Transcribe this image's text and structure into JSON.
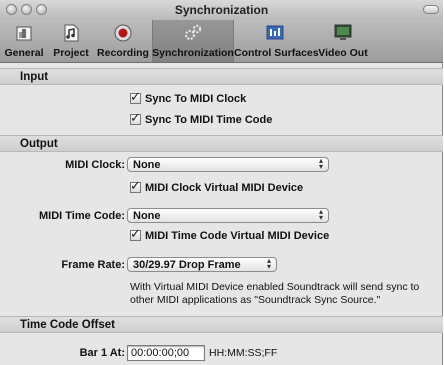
{
  "window": {
    "title": "Synchronization"
  },
  "toolbar": {
    "items": [
      {
        "label": "General",
        "icon": "general-icon"
      },
      {
        "label": "Project",
        "icon": "project-icon"
      },
      {
        "label": "Recording",
        "icon": "record-icon"
      },
      {
        "label": "Synchronization",
        "icon": "sync-gears-icon",
        "selected": true
      },
      {
        "label": "Control Surfaces",
        "icon": "control-surfaces-icon"
      },
      {
        "label": "Video Out",
        "icon": "video-out-icon"
      }
    ]
  },
  "input": {
    "header": "Input",
    "sync_midi_clock": {
      "label": "Sync To MIDI Clock",
      "checked": true
    },
    "sync_midi_time_code": {
      "label": "Sync To MIDI Time Code",
      "checked": true
    }
  },
  "output": {
    "header": "Output",
    "midi_clock_label": "MIDI Clock:",
    "midi_clock_value": "None",
    "midi_clock_virtual": {
      "label": "MIDI Clock Virtual MIDI Device",
      "checked": true
    },
    "midi_time_code_label": "MIDI Time Code:",
    "midi_time_code_value": "None",
    "midi_time_code_virtual": {
      "label": "MIDI Time Code Virtual MIDI Device",
      "checked": true
    },
    "frame_rate_label": "Frame Rate:",
    "frame_rate_value": "30/29.97 Drop Frame",
    "note": "With Virtual MIDI Device enabled Soundtrack will send sync to other MIDI applications as \"Soundtrack Sync Source.\""
  },
  "time_code_offset": {
    "header": "Time Code Offset",
    "bar_label": "Bar 1 At:",
    "bar_value": "00:00:00;00",
    "format_hint": "HH:MM:SS;FF"
  },
  "check_glyph": "✓",
  "popup_arrows": "▲▼"
}
